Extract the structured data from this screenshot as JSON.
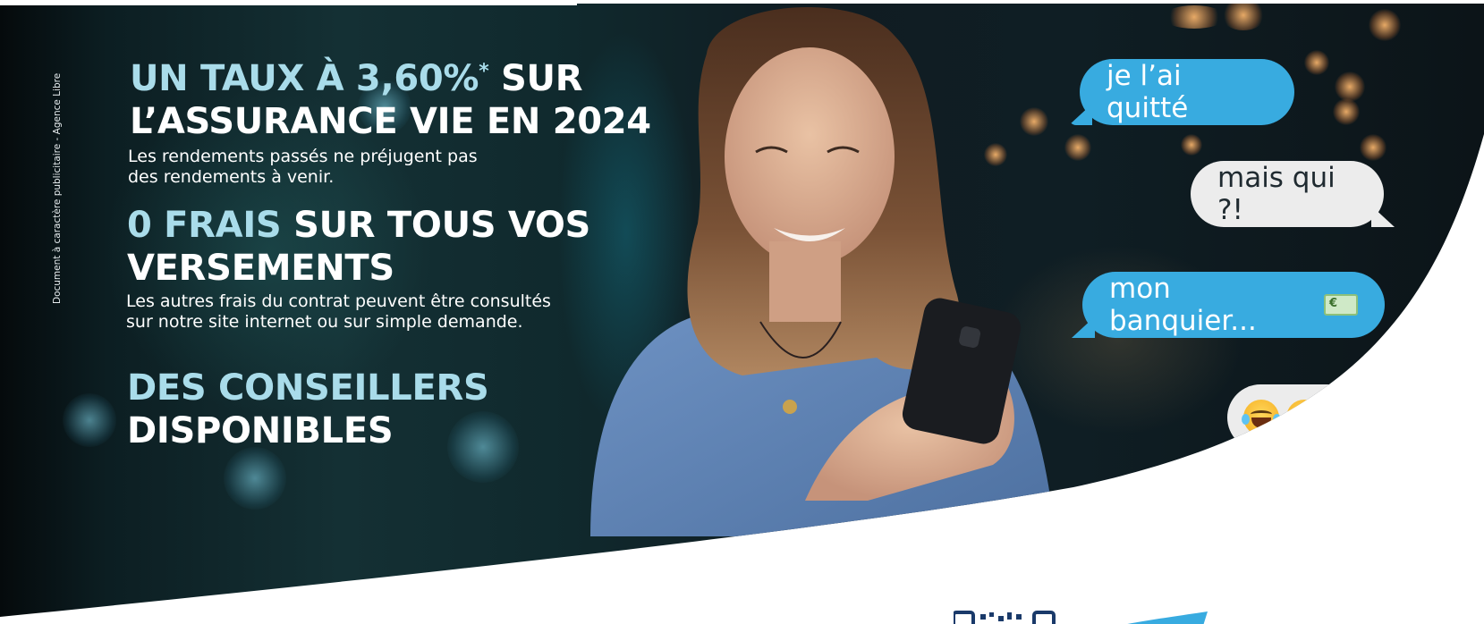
{
  "credit": "Document à caractère publicitaire - Agence Libre",
  "headline1": {
    "accent": "UN TAUX À 3,60%",
    "sup": "*",
    "rest1": " SUR",
    "line2": "L’ASSURANCE VIE EN 2024"
  },
  "sub1": {
    "line1": "Les rendements passés ne préjugent pas",
    "line2": "des rendements à venir."
  },
  "headline2": {
    "accent": "0 FRAIS",
    "rest1": " SUR TOUS VOS",
    "line2": "VERSEMENTS"
  },
  "sub2": {
    "line1": "Les autres frais du contrat peuvent être consultés",
    "line2": "sur notre site internet ou sur simple demande."
  },
  "headline3": {
    "line1": "DES CONSEILLERS",
    "line2": "DISPONIBLES"
  },
  "chat": {
    "bubble1": "je l’ai quitté",
    "bubble2": "mais qui ?!",
    "bubble3": "mon banquier...",
    "bill_symbol": "€"
  },
  "colors": {
    "accent": "#a9dcea",
    "bubble_blue": "#38abe0",
    "bubble_grey": "#ececec",
    "brand_navy": "#1c4f8c"
  }
}
